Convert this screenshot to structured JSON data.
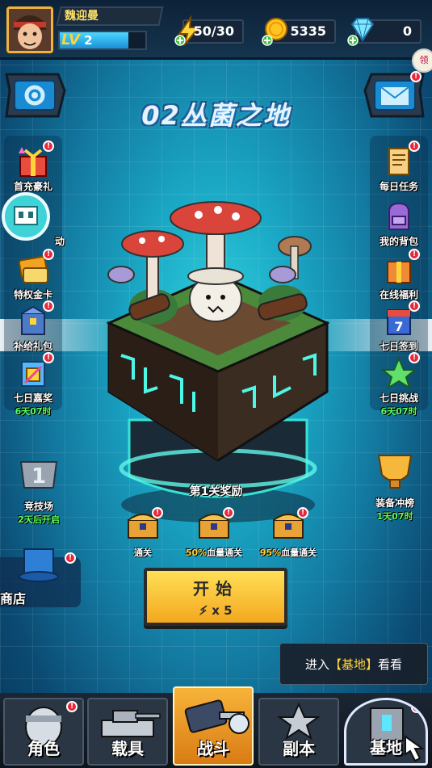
{
  "player": {
    "name": "魏迎曼",
    "level": "2",
    "level_prefix": "LV",
    "level_fill_ratio": 0.8
  },
  "resources": [
    {
      "icon": "energy-icon",
      "value": "50/30"
    },
    {
      "icon": "coin-icon",
      "value": "5335"
    },
    {
      "icon": "diamond-icon",
      "value": "0"
    }
  ],
  "top_right_tag": "领",
  "stage": {
    "title": "02丛菌之地",
    "reward_title": "第1关奖励"
  },
  "chests": [
    {
      "label": "通关",
      "highlight": ""
    },
    {
      "label": "血量通关",
      "highlight": "50%"
    },
    {
      "label": "血量通关",
      "highlight": "95%"
    }
  ],
  "start_button": {
    "label": "开始",
    "cost": "x 5"
  },
  "left_menu": [
    {
      "label": "首充豪礼",
      "timer": ""
    },
    {
      "label": "动",
      "timer": ""
    },
    {
      "label": "特权金卡",
      "timer": ""
    },
    {
      "label": "补给礼包",
      "timer": ""
    },
    {
      "label": "七日嘉奖",
      "timer": "6天07时"
    }
  ],
  "right_menu": [
    {
      "label": "每日任务",
      "timer": ""
    },
    {
      "label": "我的背包",
      "timer": ""
    },
    {
      "label": "在线福利",
      "timer": ""
    },
    {
      "label": "七日签到",
      "timer": ""
    },
    {
      "label": "七日挑战",
      "timer": "6天07时"
    }
  ],
  "arena": {
    "label": "竞技场",
    "timer": "2天后开启",
    "rank_glyph": "1"
  },
  "equip_rank": {
    "label": "装备冲榜",
    "timer": "1天07时"
  },
  "shop": {
    "label": "商店"
  },
  "tip": {
    "prefix": "进入",
    "bracket_left": "【",
    "highlight": "基地",
    "bracket_right": "】",
    "suffix": "看看"
  },
  "bottom_nav": [
    {
      "label": "角色",
      "badge": "!"
    },
    {
      "label": "载具",
      "badge": ""
    },
    {
      "label": "战斗",
      "badge": ""
    },
    {
      "label": "副本",
      "badge": ""
    },
    {
      "label": "基地",
      "badge": "!"
    }
  ],
  "colors": {
    "accent": "#ffd33a",
    "badge": "#e8283a",
    "timer": "#5dff5d"
  }
}
